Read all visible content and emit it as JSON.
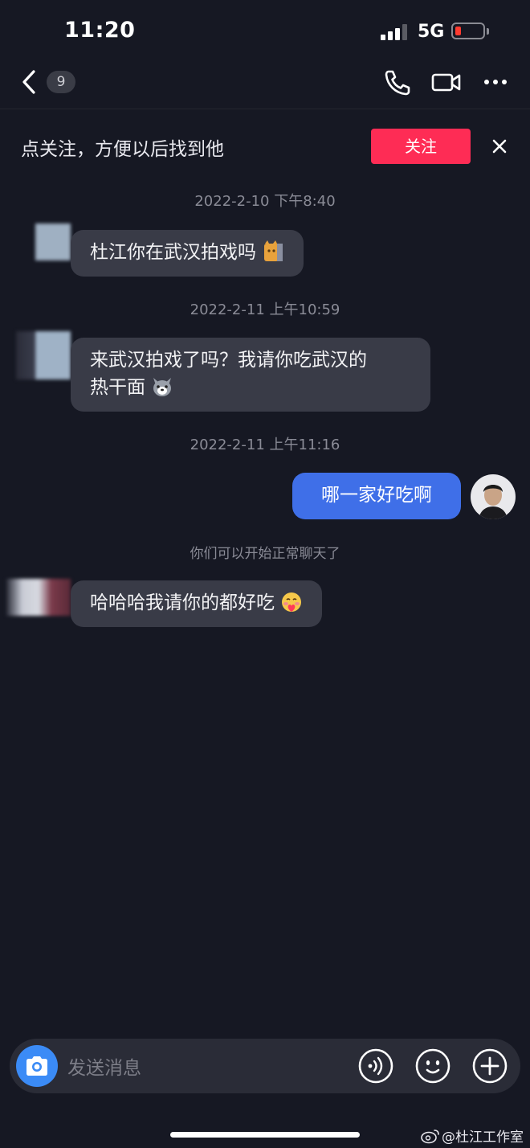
{
  "status_bar": {
    "time": "11:20",
    "network": "5G"
  },
  "nav": {
    "unread_count": "9"
  },
  "follow_banner": {
    "text": "点关注，方便以后找到他",
    "button": "关注"
  },
  "messages": [
    {
      "type": "timestamp",
      "text": "2022-2-10 下午8:40"
    },
    {
      "type": "incoming",
      "text": "杜江你在武汉拍戏吗"
    },
    {
      "type": "timestamp",
      "text": "2022-2-11 上午10:59"
    },
    {
      "type": "incoming",
      "line1": "来武汉拍戏了吗？我请你吃武汉的",
      "line2": "热干面"
    },
    {
      "type": "timestamp",
      "text": "2022-2-11 上午11:16"
    },
    {
      "type": "outgoing",
      "text": "哪一家好吃啊"
    },
    {
      "type": "system",
      "text": "你们可以开始正常聊天了"
    },
    {
      "type": "incoming",
      "text": "哈哈哈我请你的都好吃"
    }
  ],
  "input": {
    "placeholder": "发送消息"
  },
  "watermark": "@杜江工作室",
  "colors": {
    "background": "#161823",
    "accent": "#fe2c55",
    "outgoing_bubble": "#3f6fe8",
    "incoming_bubble": "#393b47"
  }
}
